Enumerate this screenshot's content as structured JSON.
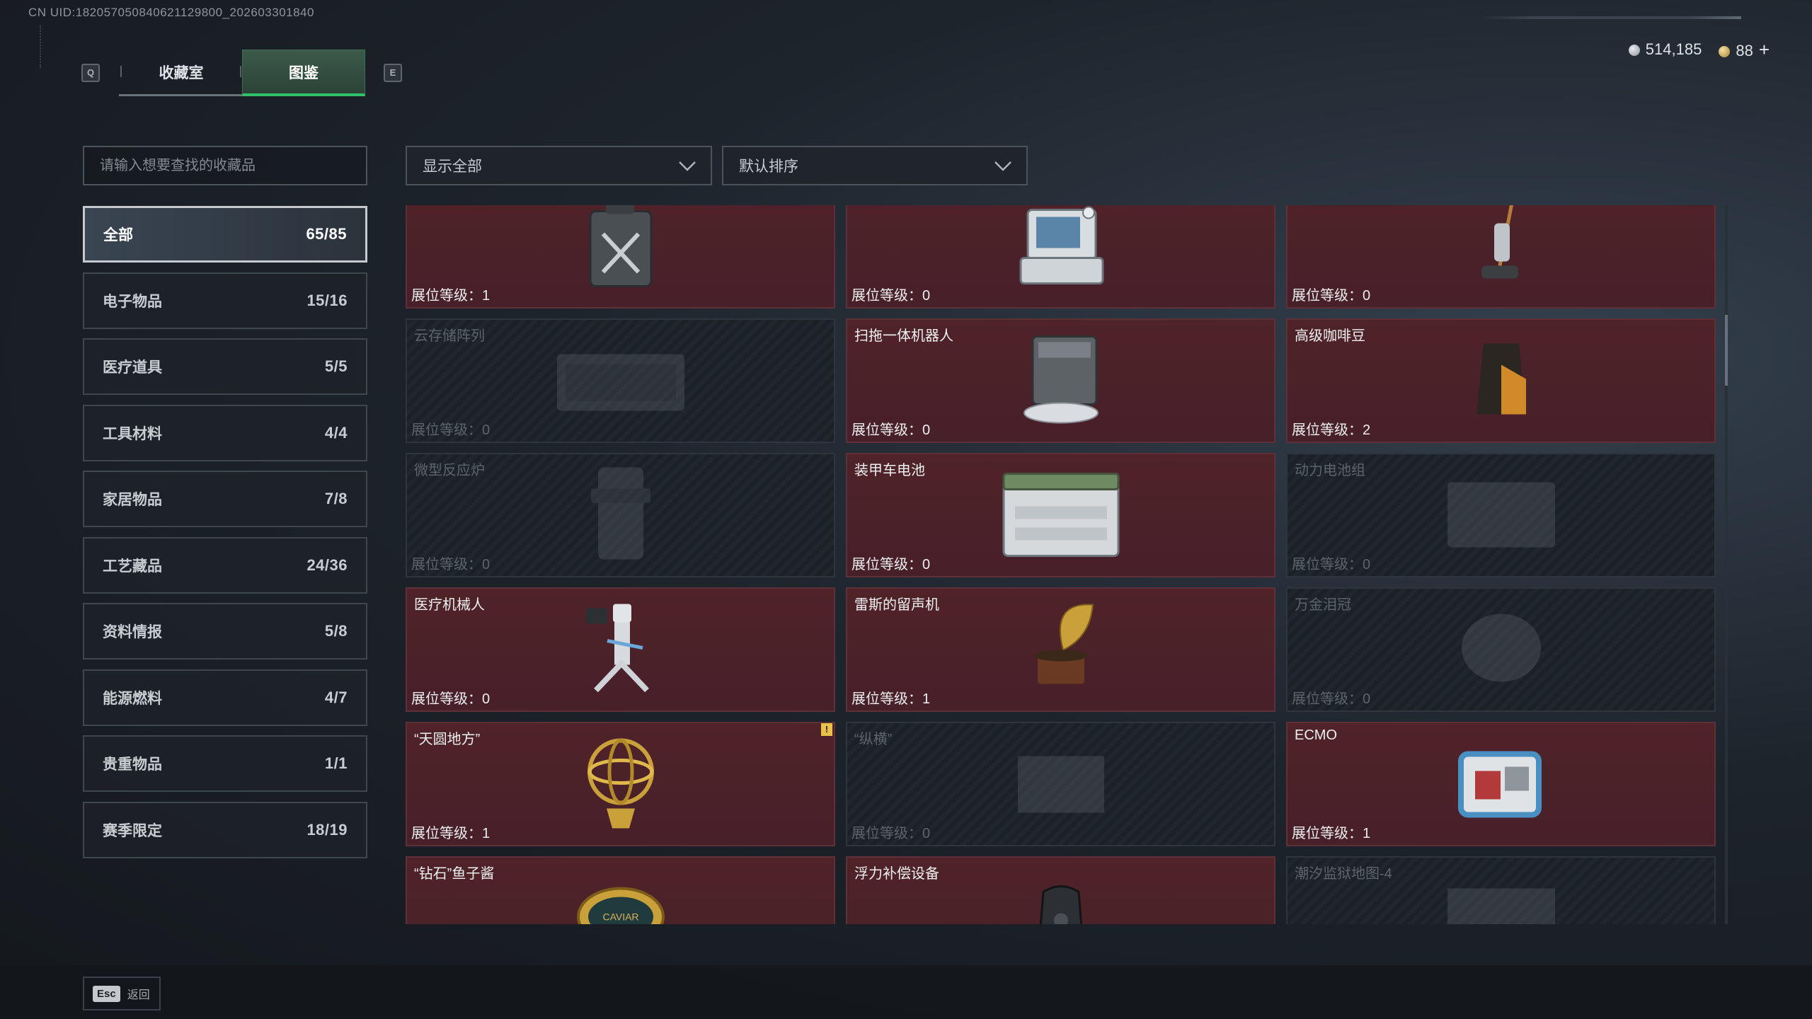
{
  "uid": "CN UID:1820570508406211298​00_202603301840",
  "tabs": {
    "prev_key": "Q",
    "next_key": "E",
    "items": [
      {
        "label": "收藏室",
        "active": false
      },
      {
        "label": "图鉴",
        "active": true
      }
    ]
  },
  "currency": {
    "silver": "514,185",
    "gold": "88",
    "plus": "+"
  },
  "search": {
    "placeholder": "请输入想要查找的收藏品"
  },
  "filters": {
    "show": "显示全部",
    "sort": "默认排序"
  },
  "categories": [
    {
      "label": "全部",
      "count": "65/85",
      "active": true
    },
    {
      "label": "电子物品",
      "count": "15/16"
    },
    {
      "label": "医疗道具",
      "count": "5/5"
    },
    {
      "label": "工具材料",
      "count": "4/4"
    },
    {
      "label": "家居物品",
      "count": "7/8"
    },
    {
      "label": "工艺藏品",
      "count": "24/36"
    },
    {
      "label": "资料情报",
      "count": "5/8"
    },
    {
      "label": "能源燃料",
      "count": "4/7"
    },
    {
      "label": "贵重物品",
      "count": "1/1"
    },
    {
      "label": "赛季限定",
      "count": "18/19"
    }
  ],
  "level_label": "展位等级：",
  "items": [
    {
      "name": "",
      "level": "1",
      "owned": true,
      "icon": "fuel-jerrycan-icon"
    },
    {
      "name": "",
      "level": "0",
      "owned": true,
      "icon": "computer-terminal-icon"
    },
    {
      "name": "",
      "level": "0",
      "owned": true,
      "icon": "floor-scrubber-icon"
    },
    {
      "name": "云存储阵列",
      "level": "0",
      "owned": false,
      "icon": "storage-array-icon"
    },
    {
      "name": "扫拖一体机器人",
      "level": "0",
      "owned": true,
      "icon": "robot-vacuum-icon"
    },
    {
      "name": "高级咖啡豆",
      "level": "2",
      "owned": true,
      "icon": "coffee-bag-icon"
    },
    {
      "name": "微型反应炉",
      "level": "0",
      "owned": false,
      "icon": "reactor-icon"
    },
    {
      "name": "装甲车电池",
      "level": "0",
      "owned": true,
      "icon": "vehicle-battery-icon"
    },
    {
      "name": "动力电池组",
      "level": "0",
      "owned": false,
      "icon": "battery-pack-icon"
    },
    {
      "name": "医疗机械人",
      "level": "0",
      "owned": true,
      "icon": "medical-robot-icon"
    },
    {
      "name": "雷斯的留声机",
      "level": "1",
      "owned": true,
      "icon": "gramophone-icon"
    },
    {
      "name": "万金泪冠",
      "level": "0",
      "owned": false,
      "icon": "crown-icon"
    },
    {
      "name": "“天圆地方”",
      "level": "1",
      "owned": true,
      "icon": "armillary-sphere-icon",
      "badge": "!"
    },
    {
      "name": "“纵横”",
      "level": "0",
      "owned": false,
      "icon": "chessboard-icon"
    },
    {
      "name": "ECMO",
      "level": "1",
      "owned": true,
      "icon": "ecmo-machine-icon"
    },
    {
      "name": "“钻石”鱼子酱",
      "level": "",
      "owned": true,
      "icon": "caviar-tin-icon",
      "tin_label": "CAVIAR"
    },
    {
      "name": "浮力补偿设备",
      "level": "",
      "owned": true,
      "icon": "bcd-vest-icon"
    },
    {
      "name": "潮汐监狱地图-4",
      "level": "",
      "owned": false,
      "icon": "map-icon"
    }
  ],
  "bottom": {
    "esc_key": "Esc",
    "esc_label": "返回"
  },
  "colors": {
    "owned_card": "#4d2227",
    "locked_card": "#1e232a",
    "tab_active_underline": "#30c06a",
    "badge": "#e9c24a"
  }
}
